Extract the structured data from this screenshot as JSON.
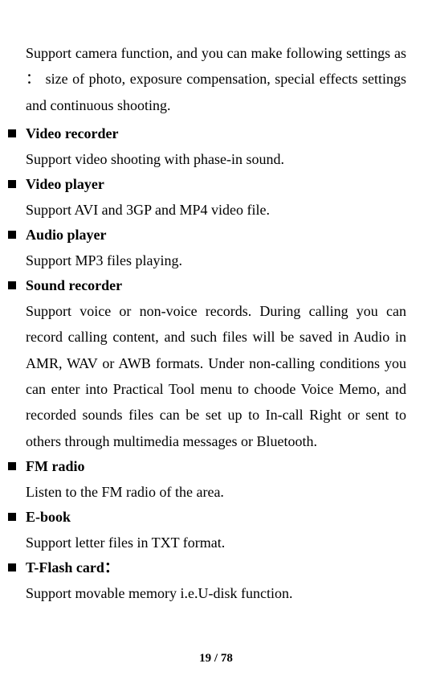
{
  "intro": "Support camera function, and you can make following settings as ： size of photo, exposure compensation, special effects settings and continuous shooting.",
  "items": [
    {
      "heading": "Video recorder",
      "body": "Support video shooting with phase-in sound."
    },
    {
      "heading": "Video player",
      "body": "Support AVI and 3GP and MP4 video file."
    },
    {
      "heading": "Audio player",
      "body": "Support MP3 files playing."
    },
    {
      "heading": "Sound recorder",
      "body": "Support voice or non-voice records. During calling you can record calling content, and such files will be saved in Audio in AMR, WAV or AWB formats. Under non-calling conditions you can enter into Practical Tool menu to choode Voice Memo, and recorded sounds files can be set up to In-call Right or sent to others through multimedia messages or Bluetooth."
    },
    {
      "heading": "FM radio",
      "body": "Listen to the FM radio of the area."
    },
    {
      "heading": "E-book",
      "body": "Support letter files in TXT format."
    },
    {
      "heading": "T-Flash card：",
      "body": "Support movable memory i.e.U-disk function."
    }
  ],
  "footer": {
    "page": "19",
    "sep": " / ",
    "total": "78"
  }
}
